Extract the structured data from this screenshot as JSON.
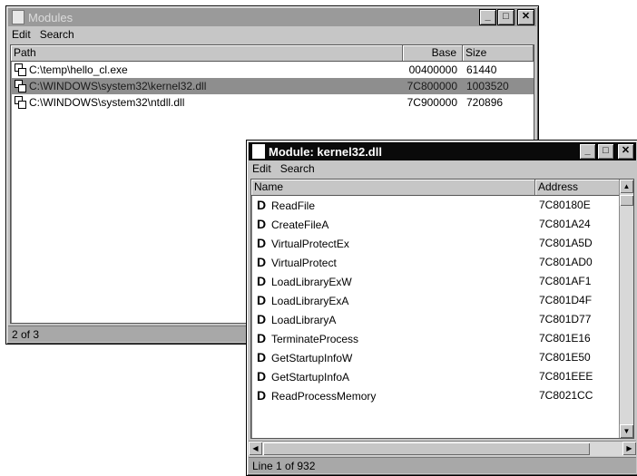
{
  "modules_window": {
    "title": "Modules",
    "menu": [
      "Edit",
      "Search"
    ],
    "columns": [
      "Path",
      "Base",
      "Size"
    ],
    "rows": [
      {
        "path": "C:\\temp\\hello_cl.exe",
        "base": "00400000",
        "size": "61440",
        "selected": false
      },
      {
        "path": "C:\\WINDOWS\\system32\\kernel32.dll",
        "base": "7C800000",
        "size": "1003520",
        "selected": true
      },
      {
        "path": "C:\\WINDOWS\\system32\\ntdll.dll",
        "base": "7C900000",
        "size": "720896",
        "selected": false
      }
    ],
    "status": "2 of 3"
  },
  "module_window": {
    "title": "Module: kernel32.dll",
    "menu": [
      "Edit",
      "Search"
    ],
    "columns": [
      "Name",
      "Address"
    ],
    "rows": [
      {
        "name": "ReadFile",
        "address": "7C80180E"
      },
      {
        "name": "CreateFileA",
        "address": "7C801A24"
      },
      {
        "name": "VirtualProtectEx",
        "address": "7C801A5D"
      },
      {
        "name": "VirtualProtect",
        "address": "7C801AD0"
      },
      {
        "name": "LoadLibraryExW",
        "address": "7C801AF1"
      },
      {
        "name": "LoadLibraryExA",
        "address": "7C801D4F"
      },
      {
        "name": "LoadLibraryA",
        "address": "7C801D77"
      },
      {
        "name": "TerminateProcess",
        "address": "7C801E16"
      },
      {
        "name": "GetStartupInfoW",
        "address": "7C801E50"
      },
      {
        "name": "GetStartupInfoA",
        "address": "7C801EEE"
      },
      {
        "name": "ReadProcessMemory",
        "address": "7C8021CC"
      }
    ],
    "status": "Line 1 of 932"
  },
  "icons": {
    "module_row": "dll-file-icon",
    "export_row": "export-d-icon",
    "min": "minimize-icon",
    "max": "maximize-icon",
    "close": "close-icon"
  }
}
